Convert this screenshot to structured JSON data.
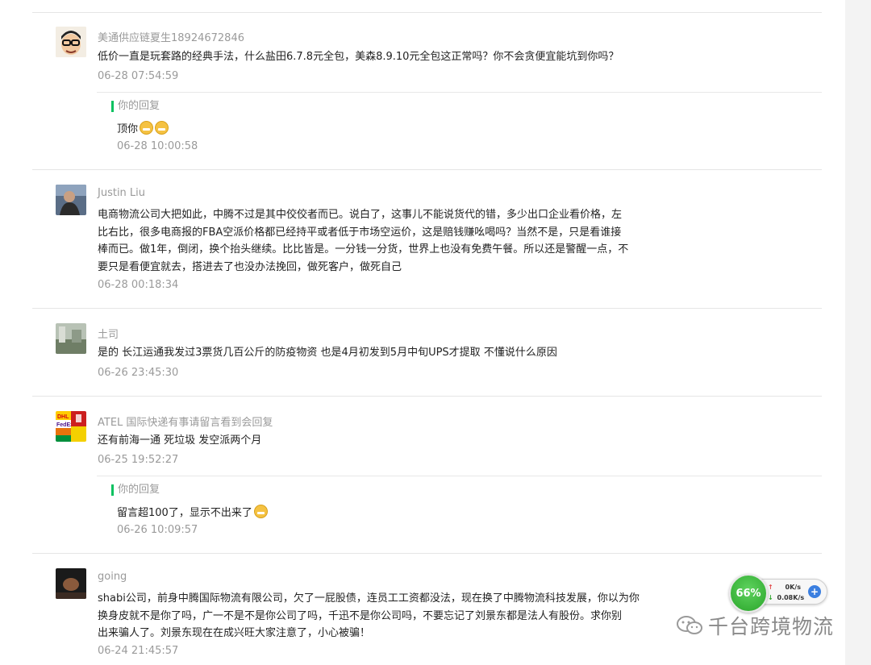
{
  "comments": [
    {
      "name": "美通供应链夏生18924672846",
      "avatar_icon": "cartoon-avatar-icon",
      "lines": [
        "低价一直是玩套路的经典手法，什么盐田6.7.8元全包，美森8.9.10元全包这正常吗？你不会贪便宜能坑到你吗？"
      ],
      "time": "06-28 07:54:59",
      "reply": {
        "label": "你的回复",
        "text": "顶你",
        "emojis": [
          "grin-emoji",
          "grin-emoji"
        ],
        "time": "06-28 10:00:58"
      }
    },
    {
      "name": "Justin Liu",
      "avatar_icon": "person-photo-avatar",
      "lines": [
        "电商物流公司大把如此，中腾不过是其中佼佼者而已。说白了，这事儿不能说货代的错，多少出口企业看价格，左",
        "比右比，很多电商报的FBA空派价格都已经持平或者低于市场空运价，这是赔钱赚吆喝吗？当然不是，只是看谁接",
        "棒而已。做1年，倒闭，换个抬头继续。比比皆是。一分钱一分货，世界上也没有免费午餐。所以还是警醒一点，不",
        "要只是看便宜就去，搭进去了也没办法挽回，做死客户，做死自己"
      ],
      "time": "06-28 00:18:34"
    },
    {
      "name": "土司",
      "avatar_icon": "landscape-photo-avatar",
      "lines": [
        "是的 长江运通我发过3票货几百公斤的防疫物资 也是4月初发到5月中旬UPS才提取 不懂说什么原因"
      ],
      "time": "06-26 23:45:30"
    },
    {
      "name": "ATEL 国际快递有事请留言看到会回复",
      "avatar_icon": "courier-logos-avatar",
      "lines": [
        "还有前海一通  死垃圾  发空派两个月"
      ],
      "time": "06-25 19:52:27",
      "reply": {
        "label": "你的回复",
        "text": "留言超100了，显示不出来了",
        "emojis": [
          "smile-emoji"
        ],
        "time": "06-26 10:09:57"
      }
    },
    {
      "name": "going",
      "avatar_icon": "dark-photo-avatar",
      "lines": [
        "shabi公司，前身中腾国际物流有限公司，欠了一屁股债，连员工工资都没法，现在换了中腾物流科技发展，你以为你",
        "换身皮就不是你了吗，广一不是不是你公司了吗，千迅不是你公司吗，不要忘记了刘景东都是法人有股份。求你别",
        "出来骗人了。刘景东现在在成兴旺大家注意了，小心被骗！"
      ],
      "time": "06-24 21:45:57"
    }
  ],
  "speed_widget": {
    "percent": "66%",
    "upload": "0K/s",
    "download": "0.08K/s",
    "plus": "+"
  },
  "watermark": {
    "text": "千台跨境物流",
    "icon": "wechat-icon"
  }
}
